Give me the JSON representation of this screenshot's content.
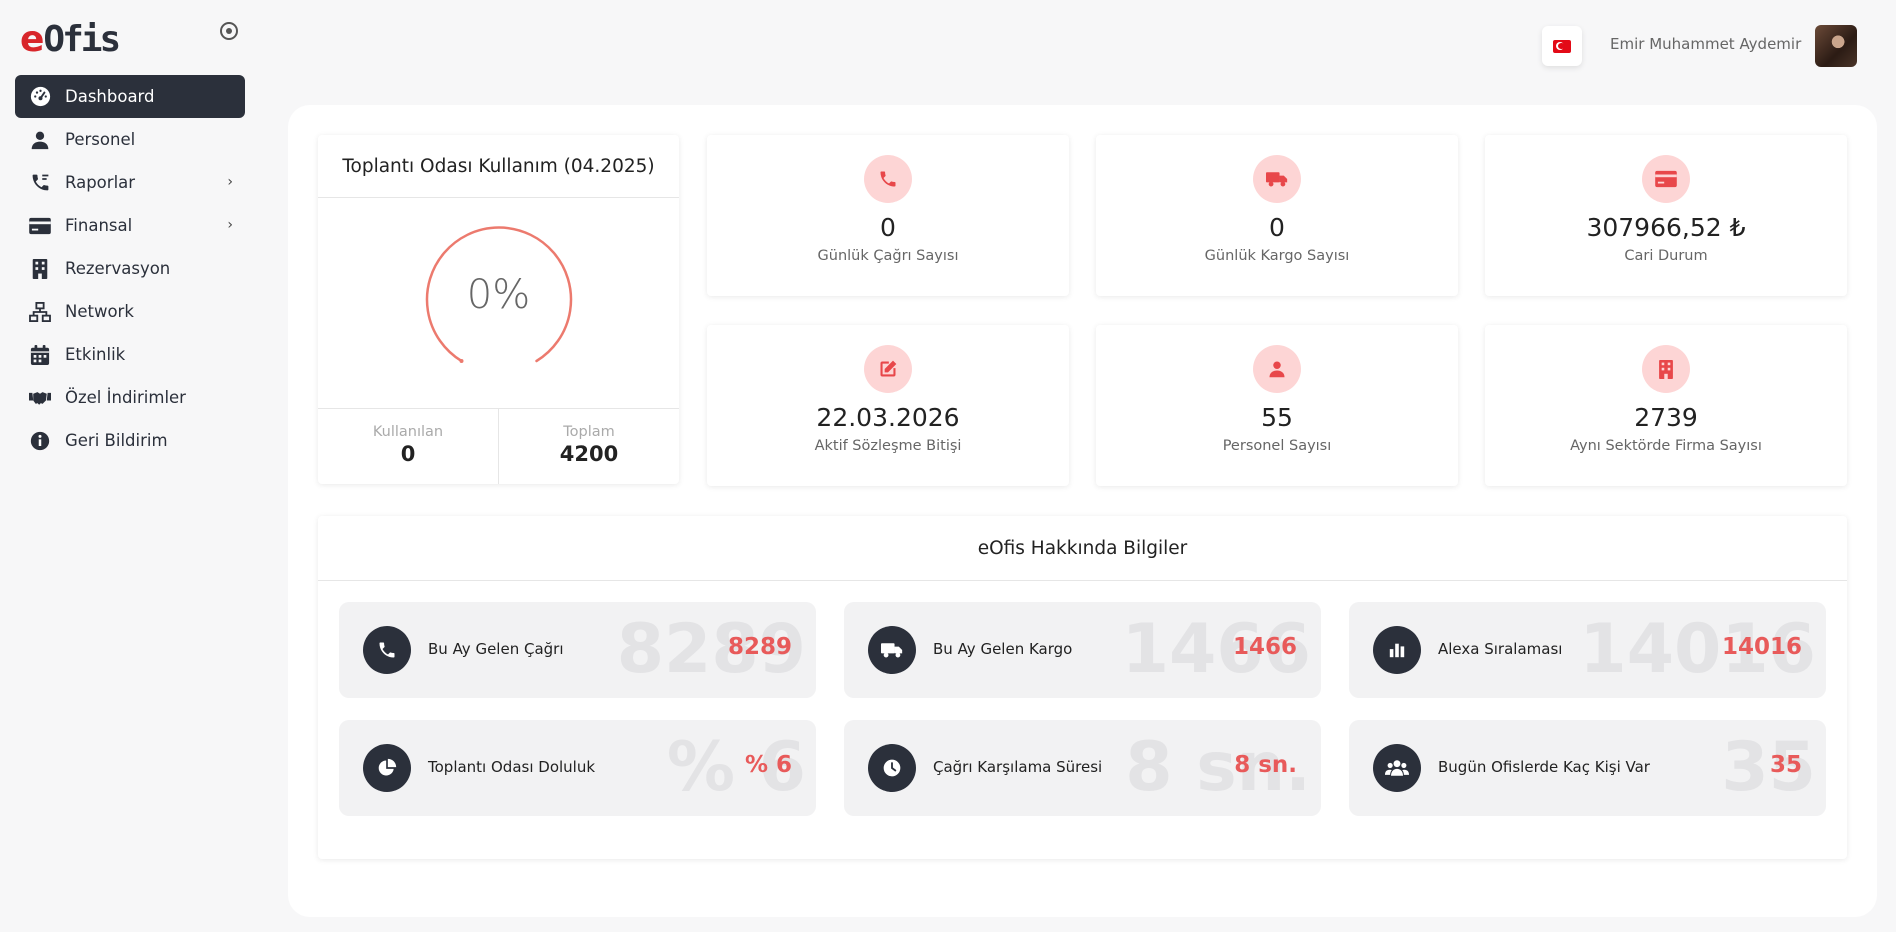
{
  "brand": {
    "logo_e": "e",
    "logo_rest": "Ofis"
  },
  "sidebar": {
    "items": [
      {
        "label": "Dashboard",
        "icon": "dashboard-icon",
        "active": true
      },
      {
        "label": "Personel",
        "icon": "user-icon"
      },
      {
        "label": "Raporlar",
        "icon": "phone-report-icon",
        "has_children": true
      },
      {
        "label": "Finansal",
        "icon": "credit-card-icon",
        "has_children": true
      },
      {
        "label": "Rezervasyon",
        "icon": "building-icon"
      },
      {
        "label": "Network",
        "icon": "network-icon"
      },
      {
        "label": "Etkinlik",
        "icon": "calendar-icon"
      },
      {
        "label": "Özel İndirimler",
        "icon": "handshake-icon"
      },
      {
        "label": "Geri Bildirim",
        "icon": "info-icon"
      }
    ]
  },
  "topbar": {
    "language": "tr",
    "user_name": "Emir Muhammet Aydemir"
  },
  "meeting_room": {
    "title": "Toplantı Odası Kullanım (04.2025)",
    "percent_label": "0%",
    "percent": 0,
    "used_label": "Kullanılan",
    "used_value": "0",
    "total_label": "Toplam",
    "total_value": "4200"
  },
  "stats": [
    {
      "value": "0",
      "label": "Günlük Çağrı Sayısı",
      "icon": "phone-icon"
    },
    {
      "value": "0",
      "label": "Günlük Kargo Sayısı",
      "icon": "truck-icon"
    },
    {
      "value": "307966,52 ₺",
      "label": "Cari Durum",
      "icon": "credit-card-icon"
    },
    {
      "value": "22.03.2026",
      "label": "Aktif Sözleşme Bitişi",
      "icon": "edit-icon"
    },
    {
      "value": "55",
      "label": "Personel Sayısı",
      "icon": "user-icon"
    },
    {
      "value": "2739",
      "label": "Aynı Sektörde Firma Sayısı",
      "icon": "building-icon"
    }
  ],
  "info": {
    "title": "eOfis Hakkında Bilgiler",
    "items": [
      {
        "label": "Bu Ay Gelen Çağrı",
        "value": "8289",
        "icon": "phone-icon"
      },
      {
        "label": "Bu Ay Gelen Kargo",
        "value": "1466",
        "icon": "truck-icon"
      },
      {
        "label": "Alexa Sıralaması",
        "value": "14016",
        "icon": "bar-chart-icon"
      },
      {
        "label": "Toplantı Odası Doluluk",
        "value": "% 6",
        "icon": "pie-chart-icon"
      },
      {
        "label": "Çağrı Karşılama Süresi",
        "value": "8 sn.",
        "icon": "clock-icon"
      },
      {
        "label": "Bugün Ofislerde Kaç Kişi Var",
        "value": "35",
        "icon": "users-icon"
      }
    ]
  },
  "colors": {
    "accent": "#e85a5a",
    "dark": "#2b303b",
    "icon_bg": "#fdd5d5",
    "icon_fg": "#e8474a",
    "logo_red": "#d8262b"
  }
}
